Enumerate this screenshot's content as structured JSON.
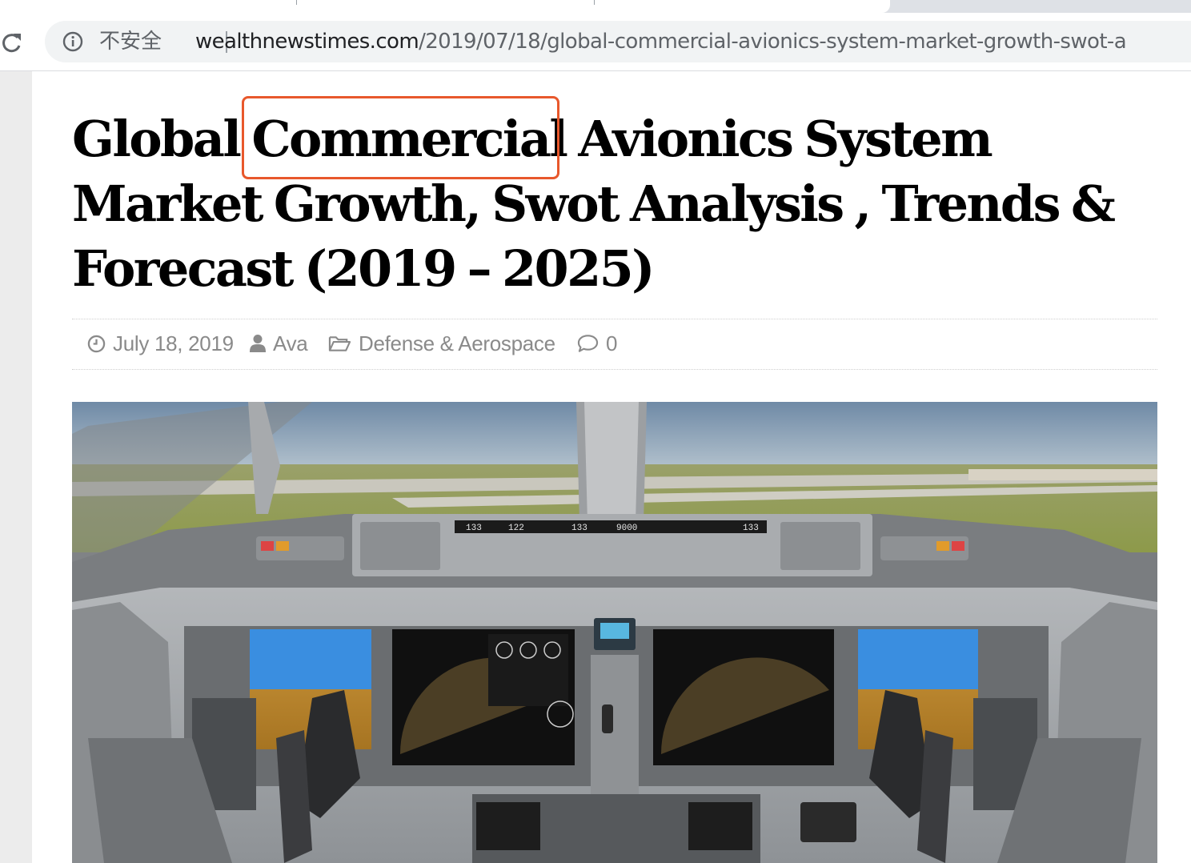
{
  "browser": {
    "security_label": "不安全",
    "url_host": "wealthnewstimes.com",
    "url_path": "/2019/07/18/global-commercial-avionics-system-market-growth-swot-a"
  },
  "article": {
    "title": "Global Commercial Avionics System Market Growth, Swot Analysis , Trends & Forecast (2019 – 2025)",
    "highlighted_word": "Commercial",
    "meta": {
      "date": "July 18, 2019",
      "author": "Ava",
      "category": "Defense & Aerospace",
      "comments": "0"
    },
    "image_subject": "aircraft cockpit with avionics displays"
  },
  "colors": {
    "highlight_border": "#e8582c",
    "meta_text": "#8a8a8a"
  }
}
